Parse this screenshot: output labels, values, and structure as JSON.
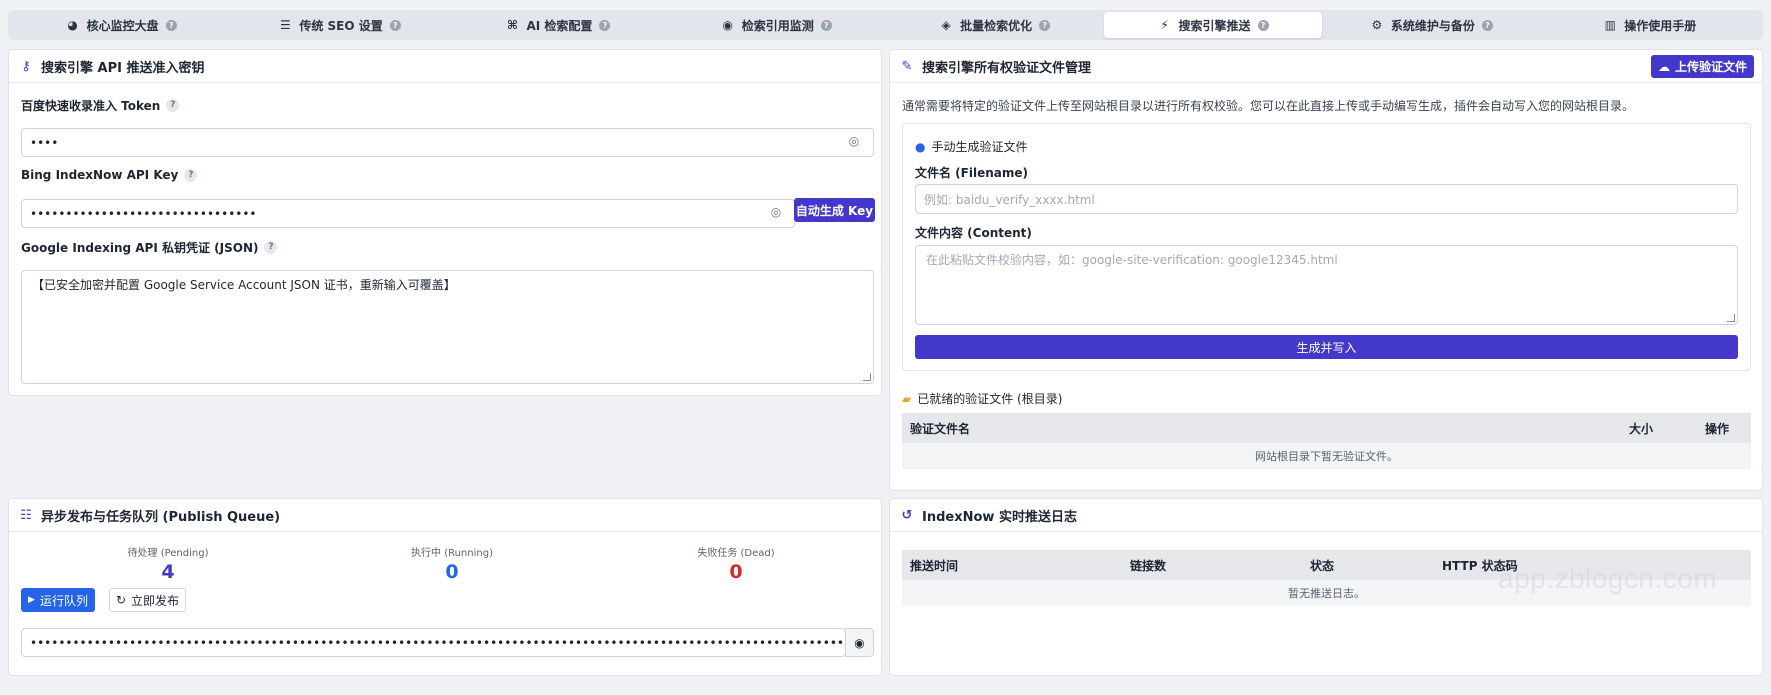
{
  "tabs": [
    {
      "icon": "chart-pie-icon",
      "glyph": "◕",
      "label": "核心监控大盘"
    },
    {
      "icon": "sliders-icon",
      "glyph": "☰",
      "label": "传统 SEO 设置"
    },
    {
      "icon": "sitemap-icon",
      "glyph": "⌘",
      "label": "AI 检索配置"
    },
    {
      "icon": "eye-icon",
      "glyph": "◉",
      "label": "检索引用监测"
    },
    {
      "icon": "layers-icon",
      "glyph": "◈",
      "label": "批量检索优化"
    },
    {
      "icon": "bolt-icon",
      "glyph": "⚡",
      "label": "搜索引擎推送",
      "active": true
    },
    {
      "icon": "cogs-icon",
      "glyph": "⚙",
      "label": "系统维护与备份"
    },
    {
      "icon": "book-icon",
      "glyph": "▥",
      "label": "操作使用手册"
    }
  ],
  "api_panel": {
    "title": "搜索引擎 API 推送准入密钥",
    "baidu": {
      "label": "百度快速收录准入 Token",
      "value": "••••"
    },
    "bing": {
      "label": "Bing IndexNow API Key",
      "value": "••••••••••••••••••••••••••••••••",
      "button": "自动生成 Key"
    },
    "google": {
      "label": "Google Indexing API 私钥凭证 (JSON)",
      "value": "【已安全加密并配置 Google Service Account JSON 证书，重新输入可覆盖】"
    }
  },
  "verify_panel": {
    "title": "搜索引擎所有权验证文件管理",
    "upload_button": "上传验证文件",
    "description": "通常需要将特定的验证文件上传至网站根目录以进行所有权校验。您可以在此直接上传或手动编写生成，插件会自动写入您的网站根目录。",
    "manual_title": "手动生成验证文件",
    "filename_label": "文件名 (Filename)",
    "filename_placeholder": "例如: baidu_verify_xxxx.html",
    "content_label": "文件内容 (Content)",
    "content_placeholder": "在此粘贴文件校验内容，如：google-site-verification: google12345.html",
    "generate_button": "生成并写入",
    "ready_title": "已就绪的验证文件 (根目录)",
    "table_headers": [
      "验证文件名",
      "大小",
      "操作"
    ],
    "empty_text": "网站根目录下暂无验证文件。"
  },
  "queue_panel": {
    "title": "异步发布与任务队列 (Publish Queue)",
    "stats": [
      {
        "label": "待处理 (Pending)",
        "value": "4",
        "color": "#4338ca"
      },
      {
        "label": "执行中 (Running)",
        "value": "0",
        "color": "#2563eb"
      },
      {
        "label": "失败任务 (Dead)",
        "value": "0",
        "color": "#dc2626"
      }
    ],
    "run_button": "运行队列",
    "publish_button": "立即发布",
    "token_value": "••••••••••••••••••••••••••••••••••••••••••••••••••••••••••••••••••••••••••••••••••••••••••••••••••••••••••••••••••••••••"
  },
  "log_panel": {
    "title": "IndexNow 实时推送日志",
    "table_headers": [
      "推送时间",
      "链接数",
      "状态",
      "HTTP 状态码"
    ],
    "empty_text": "暂无推送日志。"
  },
  "watermark": "app.zblogcn.com",
  "colors": {
    "accent": "#4338ca",
    "pending": "#4338ca",
    "running": "#2563eb",
    "dead": "#dc2626"
  }
}
